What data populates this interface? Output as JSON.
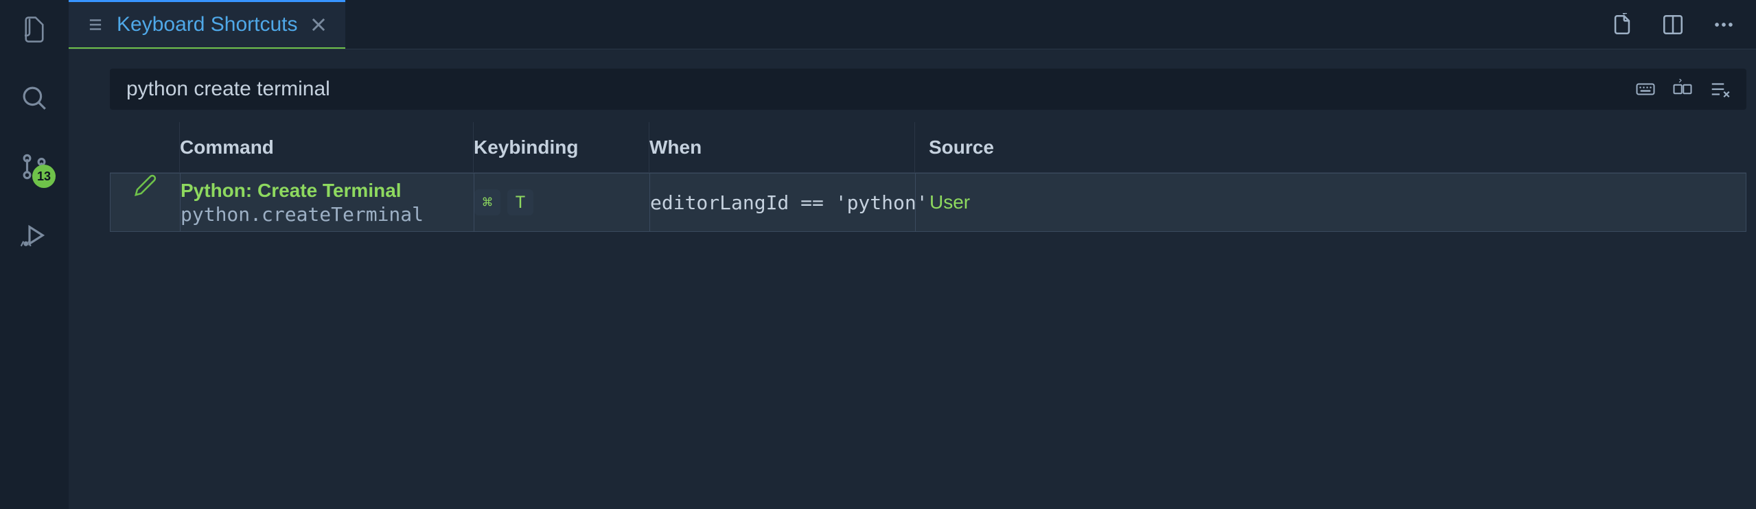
{
  "activity": {
    "scm_badge": "13"
  },
  "tab": {
    "title": "Keyboard Shortcuts"
  },
  "search": {
    "value": "python create terminal"
  },
  "headers": {
    "command": "Command",
    "keybinding": "Keybinding",
    "when": "When",
    "source": "Source"
  },
  "rows": [
    {
      "title": "Python: Create Terminal",
      "id": "python.createTerminal",
      "keys": [
        "⌘",
        "T"
      ],
      "when": "editorLangId == 'python'",
      "source": "User"
    }
  ]
}
